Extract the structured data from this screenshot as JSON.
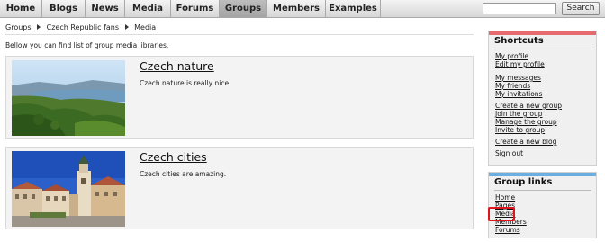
{
  "nav": {
    "tabs": [
      {
        "label": "Home"
      },
      {
        "label": "Blogs"
      },
      {
        "label": "News"
      },
      {
        "label": "Media"
      },
      {
        "label": "Forums"
      },
      {
        "label": "Groups",
        "active": true
      },
      {
        "label": "Members"
      },
      {
        "label": "Examples"
      }
    ],
    "search_value": "",
    "search_button": "Search"
  },
  "breadcrumb": {
    "items": [
      "Groups",
      "Czech Republic fans"
    ],
    "current": "Media"
  },
  "intro": "Bellow you can find list of group media libraries.",
  "libraries": [
    {
      "title": "Czech nature",
      "description": "Czech nature is really nice.",
      "image": "landscape-photo"
    },
    {
      "title": "Czech cities",
      "description": "Czech cities are amazing.",
      "image": "town-square-photo"
    }
  ],
  "shortcuts": {
    "title": "Shortcuts",
    "accent": "#e66b6e",
    "links": [
      "My profile",
      "Edit my profile",
      "My messages",
      "My friends",
      "My invitations",
      "Create a new group",
      "Join the group",
      "Manage the group",
      "Invite to group",
      "Create a new blog",
      "Sign out"
    ]
  },
  "group_links": {
    "title": "Group links",
    "accent": "#6aafe0",
    "links": [
      "Home",
      "Pages",
      "Media",
      "Members",
      "Forums"
    ],
    "highlighted": "Media",
    "highlight_color": "#e0141b"
  }
}
